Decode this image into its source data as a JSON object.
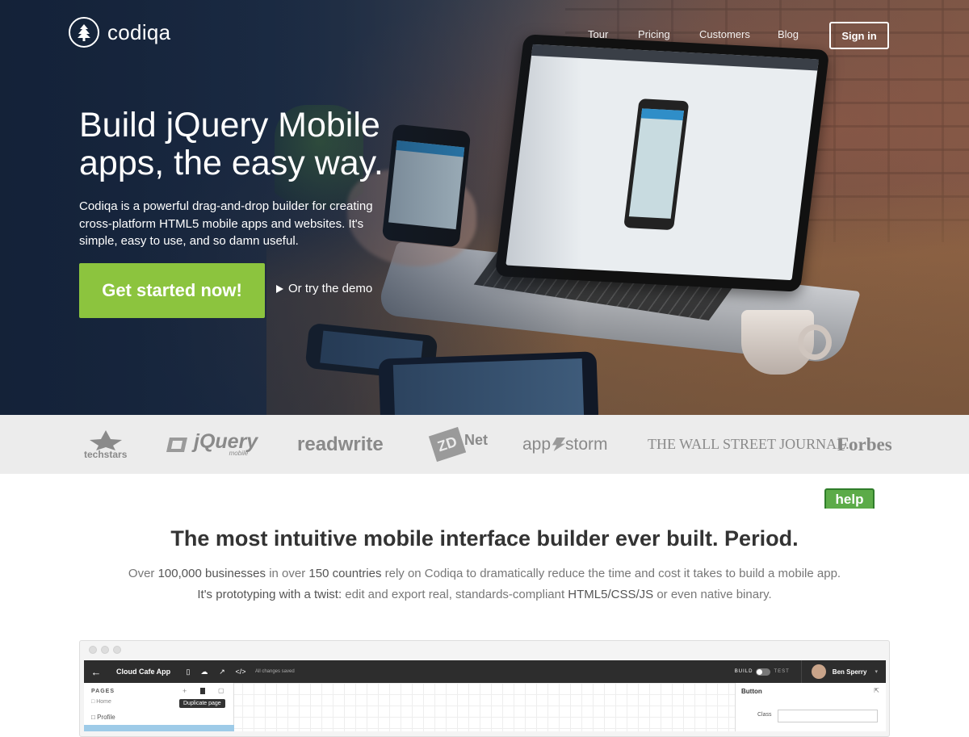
{
  "brand": {
    "name": "codiqa"
  },
  "nav": {
    "items": [
      "Tour",
      "Pricing",
      "Customers",
      "Blog"
    ],
    "signin": "Sign in"
  },
  "hero": {
    "headline_line1": "Build jQuery Mobile",
    "headline_line2": "apps, the easy way.",
    "subtext": "Codiqa is a powerful drag-and-drop builder for creating cross-platform HTML5 mobile apps and websites. It's simple, easy to use, and so damn useful.",
    "cta": "Get started now!",
    "demo_link": "Or try the demo"
  },
  "press_logos": [
    "techstars",
    "jQuery",
    "mobile",
    "readwrite",
    "ZD",
    "Net",
    "app",
    "storm",
    "THE WALL STREET JOURNAL.",
    "Forbes"
  ],
  "help_tab": "help",
  "section": {
    "title": "The most intuitive mobile interface builder ever built. Period.",
    "p1_a": "Over ",
    "p1_b": "100,000 businesses",
    "p1_c": " in over ",
    "p1_d": "150 countries",
    "p1_e": " rely on Codiqa to dramatically reduce the time and cost it takes to build a mobile app.",
    "p2_a": "It's prototyping with a twist:",
    "p2_b": " edit and export real, standards-compliant ",
    "p2_c": "HTML5/CSS/JS",
    "p2_d": " or even native binary."
  },
  "app_preview": {
    "app_name": "Cloud Cafe App",
    "saved": "All changes saved",
    "build": "BUILD",
    "test": "TEST",
    "user": "Ben Sperry",
    "pages_label": "PAGES",
    "pages": [
      "Home",
      "Profile"
    ],
    "tooltip": "Duplicate page",
    "panel_title": "Button",
    "class_label": "Class"
  },
  "colors": {
    "cta": "#8cc43e",
    "help": "#5cab48",
    "strip": "#ececec",
    "appbar": "#2d2d2d"
  }
}
